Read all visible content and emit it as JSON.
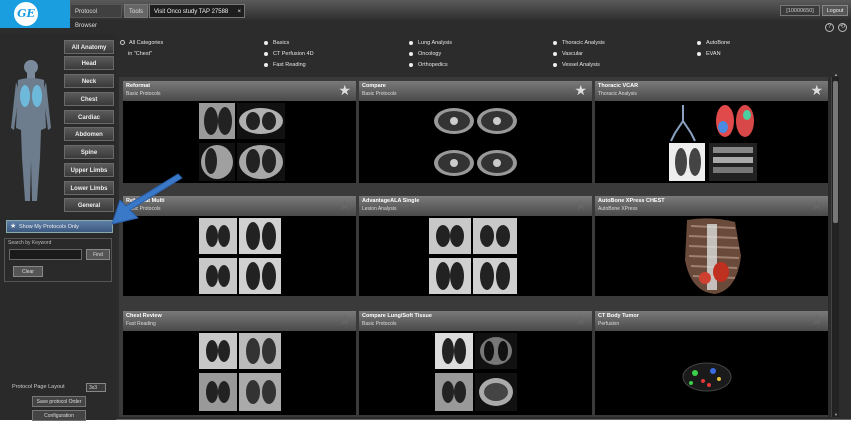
{
  "header": {
    "tabs": [
      "Protocol Browser",
      "Tools",
      "Visit Onco study TAP 27588"
    ],
    "close_glyph": "×",
    "session": "[10000650]",
    "logout": "Logout",
    "help": "?",
    "refresh": "⟲",
    "logo": "GE"
  },
  "sidebar": {
    "anatomy_buttons": [
      "All Anatomy",
      "Head",
      "Neck",
      "Chest",
      "Cardiac",
      "Abdomen",
      "Spine",
      "Upper Limbs",
      "Lower Limbs",
      "General"
    ],
    "show_mine": "Show My Protocols Only",
    "search_label": "Search by Keyword",
    "find": "Find",
    "clear": "Clear",
    "layout_label": "Protocol Page Layout",
    "layout_value": "3x3",
    "save_order": "Save protocol Order",
    "configuration": "Configuration"
  },
  "categories": {
    "all": "All Categories",
    "chest": "in \"Chest\"",
    "items": [
      "Basics",
      "CT Perfusion 4D",
      "Fast Reading",
      "Lung Analysis",
      "Oncology",
      "Orthopedics",
      "Thoracic Analysis",
      "Vascular",
      "Vessel Analysis",
      "AutoBone",
      "EVAN"
    ]
  },
  "cards": [
    {
      "title": "Reformat",
      "subtitle": "Basic Protocols",
      "starred": true
    },
    {
      "title": "Compare",
      "subtitle": "Basic Protocols",
      "starred": true
    },
    {
      "title": "Thoracic VCAR",
      "subtitle": "Thoracic Analysis",
      "starred": true
    },
    {
      "title": "Reformat Multi",
      "subtitle": "Basic Protocols",
      "starred": false
    },
    {
      "title": "AdvantageALA Single",
      "subtitle": "Lesion Analysis",
      "starred": false
    },
    {
      "title": "AutoBone XPress CHEST",
      "subtitle": "AutoBone XPress",
      "starred": false
    },
    {
      "title": "Chest Review",
      "subtitle": "Fast Reading",
      "starred": false
    },
    {
      "title": "Compare Lung/Soft Tissue",
      "subtitle": "Basic Protocols",
      "starred": false
    },
    {
      "title": "CT Body Tumor",
      "subtitle": "Perfusion",
      "starred": false
    }
  ],
  "star_glyph": "★",
  "scroll": {
    "up": "▲",
    "down": "▼",
    "position": 0
  }
}
